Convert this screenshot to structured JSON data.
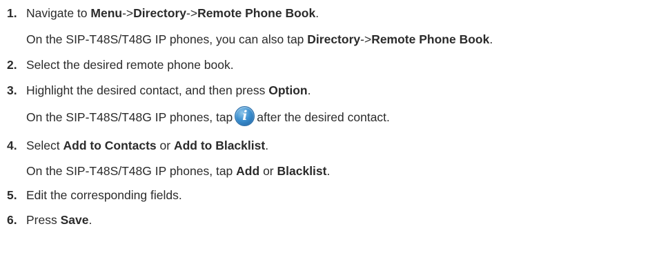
{
  "steps": [
    {
      "number": "1.",
      "line1": [
        "Navigate to ",
        "Menu",
        "->",
        "Directory",
        "->",
        "Remote Phone Book",
        "."
      ],
      "line2": [
        "On the SIP-T48S/T48G IP phones, you can also tap ",
        "Directory",
        "->",
        "Remote Phone Book",
        "."
      ]
    },
    {
      "number": "2.",
      "line1": [
        "Select the desired remote phone book."
      ]
    },
    {
      "number": "3.",
      "line1": [
        "Highlight the desired contact, and then press ",
        "Option",
        "."
      ],
      "line2": [
        "On the SIP-T48S/T48G IP phones, tap",
        "i",
        "after the desired contact."
      ]
    },
    {
      "number": "4.",
      "line1": [
        "Select ",
        "Add to Contacts",
        " or ",
        "Add to Blacklist",
        "."
      ],
      "line2": [
        "On the SIP-T48S/T48G IP phones, tap ",
        "Add",
        " or ",
        "Blacklist",
        "."
      ]
    },
    {
      "number": "5.",
      "line1": [
        "Edit the corresponding fields."
      ]
    },
    {
      "number": "6.",
      "line1": [
        "Press ",
        "Save",
        "."
      ]
    }
  ],
  "icons": {
    "info": "info-icon"
  },
  "colors": {
    "text": "#2b2b2b",
    "icon_blue": "#3b8fcf"
  }
}
